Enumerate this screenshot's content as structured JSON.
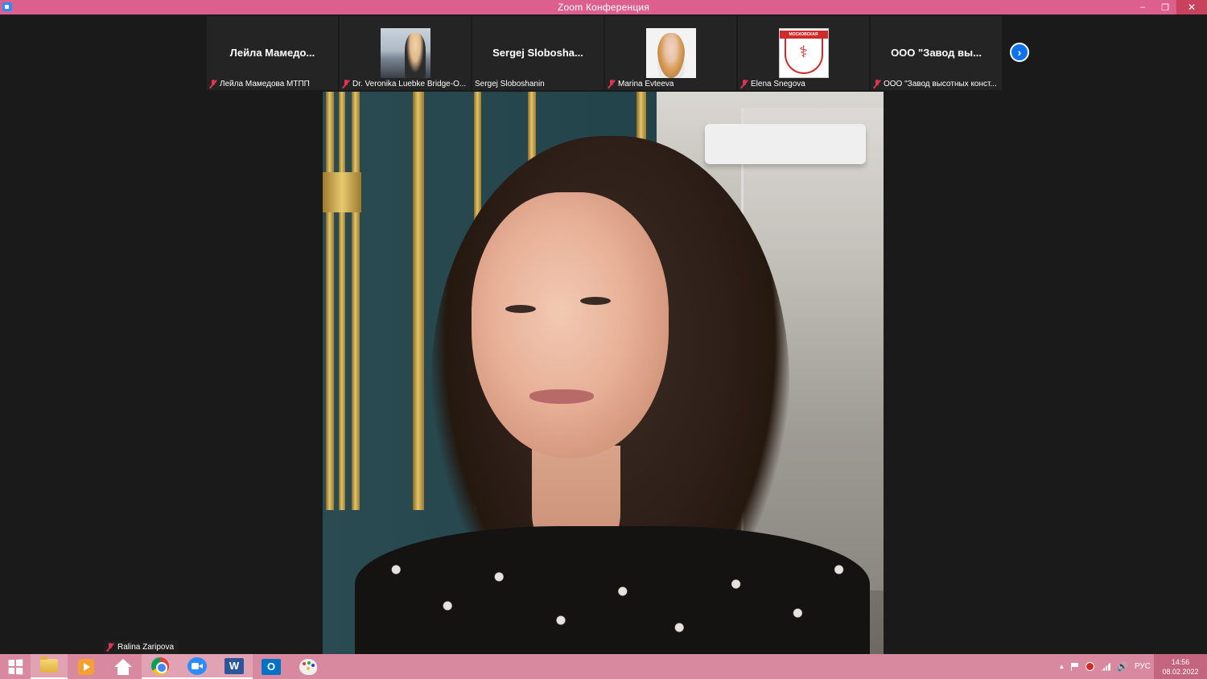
{
  "window": {
    "title": "Zoom Конференция",
    "minimize": "–",
    "restore": "❐",
    "close": "✕"
  },
  "participants": [
    {
      "display": "Лейла  Мамедо...",
      "label": "Лейла Мамедова МТПП",
      "muted": true,
      "thumb": "none"
    },
    {
      "display": "",
      "label": "Dr. Veronika Luebke Bridge-O...",
      "muted": true,
      "thumb": "photo-veronika"
    },
    {
      "display": "Sergej  Sloboshа...",
      "label": "Sergej Sloboshanin",
      "muted": false,
      "thumb": "none"
    },
    {
      "display": "",
      "label": "Marina Evteeva",
      "muted": true,
      "thumb": "photo-marina"
    },
    {
      "display": "",
      "label": "Elena Snegova",
      "muted": true,
      "thumb": "logo-mtpp"
    },
    {
      "display": "ООО  \"Завод  вы...",
      "label": "ООО \"Завод высотных конст...",
      "muted": true,
      "thumb": "none"
    }
  ],
  "elena_logo_text": "МОСКОВСКАЯ",
  "next_icon": "chevron-right-icon",
  "active_speaker": {
    "name": "Ralina Zaripova",
    "muted": true
  },
  "taskbar": {
    "items": [
      "start",
      "file-explorer",
      "media-player",
      "home",
      "chrome",
      "zoom",
      "word",
      "outlook",
      "paint"
    ],
    "word_glyph": "W",
    "outlook_glyph": "O",
    "tray_caret": "▲",
    "speaker_glyph": "🔊",
    "language": "РУС",
    "time": "14:56",
    "date": "08.02.2022"
  },
  "colors": {
    "titlebar": "#dc5f8e",
    "taskbar": "#d9899f",
    "zoom_blue": "#0e72ed",
    "mute_red": "#e0344f"
  }
}
